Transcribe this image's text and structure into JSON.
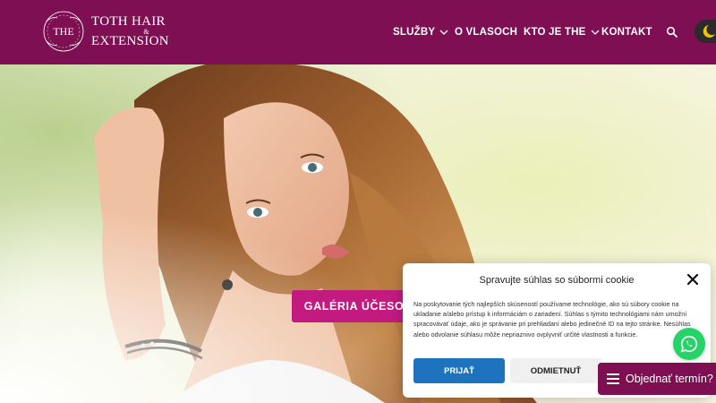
{
  "brand": {
    "monogram": "THE",
    "line1": "TOTH HAIR",
    "amp": "&",
    "line3": "EXTENSION",
    "color_header": "#7d0f52"
  },
  "nav": {
    "items": [
      {
        "label": "SLUŽBY",
        "has_dropdown": true
      },
      {
        "label": "O VLASOCH",
        "has_dropdown": false
      },
      {
        "label": "KTO JE THE",
        "has_dropdown": true
      },
      {
        "label": "KONTAKT",
        "has_dropdown": false
      }
    ],
    "search_icon": "search-icon",
    "theme_icon": "moon-icon"
  },
  "hero": {
    "cta_label": "GALÉRIA ÚČESOV",
    "cta_color": "#c21a7f"
  },
  "cookie": {
    "title": "Spravujte súhlas so súbormi cookie",
    "body": "Na poskytovanie tých najlepších skúseností používame technológie, ako sú súbory cookie na ukladanie a/alebo prístup k informáciám o zariadení. Súhlas s týmito technológiami nám umožní spracovávať údaje, ako je správanie pri prehliadaní alebo jedinečné ID na tejto stránke. Nesúhlas alebo odvolanie súhlasu môže nepriaznivo ovplyvniť určité vlastnosti a funkcie.",
    "accept_label": "PRIJAŤ",
    "deny_label": "ODMIETNUŤ",
    "accept_color": "#1e73be"
  },
  "floating": {
    "whatsapp_icon": "whatsapp-icon",
    "book_label": "Objednať termín?"
  }
}
